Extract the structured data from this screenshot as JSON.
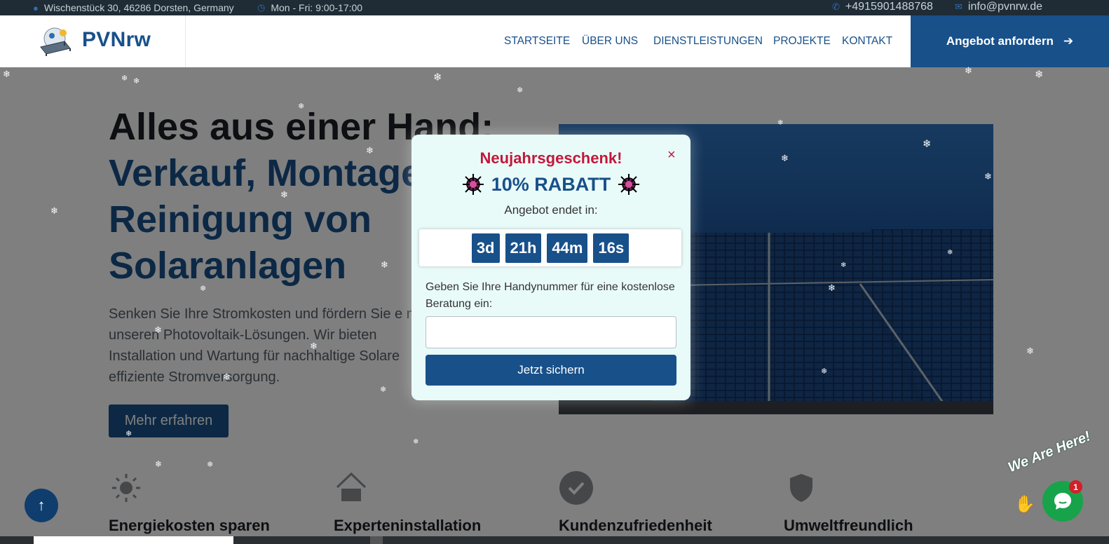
{
  "topbar": {
    "address": "Wischenstück 30, 46286 Dorsten, Germany",
    "hours": "Mon - Fri: 9:00-17:00",
    "phone": "+4915901488768",
    "email": "info@pvnrw.de"
  },
  "nav": {
    "brand": "PVNrw",
    "items": [
      "STARTSEITE",
      "ÜBER UNS",
      "DIENSTLEISTUNGEN",
      "PROJEKTE",
      "KONTAKT"
    ],
    "cta": "Angebot anfordern"
  },
  "hero": {
    "title_line1": "Alles aus einer Hand:",
    "title_line2": "Verkauf, Montage",
    "title_line3": "Reinigung von",
    "title_line4": "Solaranlagen",
    "lead": "Senken Sie Ihre Stromkosten und fördern Sie e mit unseren Photovoltaik-Lösungen. Wir bieten Installation und Wartung für nachhaltige Solare effiziente Stromversorgung.",
    "more_button": "Mehr erfahren"
  },
  "features": [
    {
      "icon": "sun-icon",
      "label": "Energiekosten sparen"
    },
    {
      "icon": "house-icon",
      "label": "Experteninstallation"
    },
    {
      "icon": "check-circle-icon",
      "label": "Kundenzufriedenheit"
    },
    {
      "icon": "shield-icon",
      "label": "Umweltfreundlich"
    }
  ],
  "popup": {
    "title": "Neujahrsgeschenk!",
    "discount": "10% RABATT",
    "ends_label": "Angebot endet in:",
    "timer": {
      "days": "3d",
      "hours": "21h",
      "minutes": "44m",
      "seconds": "16s"
    },
    "prompt": "Geben Sie Ihre Handynummer für eine kostenlose Beratung ein:",
    "phone_value": "",
    "submit": "Jetzt sichern",
    "close_symbol": "×"
  },
  "chat": {
    "teaser": "We Are Here!",
    "unread": "1"
  },
  "scroll_top_symbol": "↑",
  "colors": {
    "brand_blue": "#18508a",
    "accent_red": "#c2183a",
    "topbar_bg": "#1f2b35",
    "chat_green": "#17a34a"
  }
}
